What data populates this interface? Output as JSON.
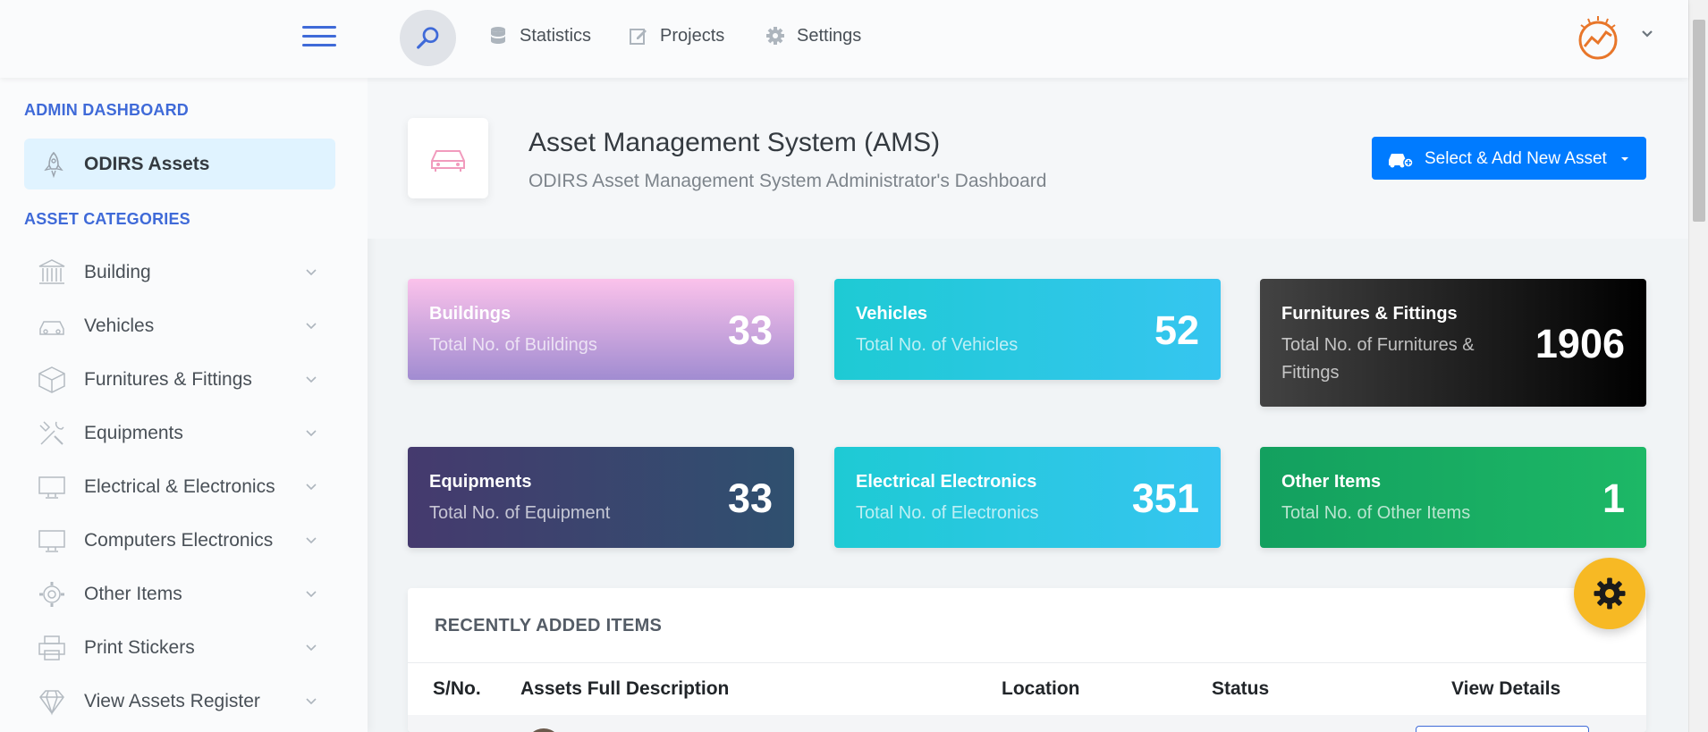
{
  "header": {
    "nav": [
      {
        "label": "Statistics",
        "icon": "database-icon"
      },
      {
        "label": "Projects",
        "icon": "edit-icon"
      },
      {
        "label": "Settings",
        "icon": "gear-icon"
      }
    ]
  },
  "sidebar": {
    "admin_heading": "ADMIN DASHBOARD",
    "active_item": {
      "label": "ODIRS Assets",
      "icon": "rocket-icon"
    },
    "categories_heading": "ASSET CATEGORIES",
    "items": [
      {
        "label": "Building",
        "icon": "bank-icon"
      },
      {
        "label": "Vehicles",
        "icon": "car-icon"
      },
      {
        "label": "Furnitures & Fittings",
        "icon": "box-icon"
      },
      {
        "label": "Equipments",
        "icon": "tools-icon"
      },
      {
        "label": "Electrical & Electronics",
        "icon": "monitor-icon"
      },
      {
        "label": "Computers Electronics",
        "icon": "monitor-icon"
      },
      {
        "label": "Other Items",
        "icon": "gear-icon"
      },
      {
        "label": "Print Stickers",
        "icon": "printer-icon"
      },
      {
        "label": "View Assets Register",
        "icon": "diamond-icon"
      }
    ]
  },
  "page": {
    "title": "Asset Management System (AMS)",
    "subtitle": "ODIRS Asset Management System Administrator's Dashboard",
    "add_button": "Select & Add New Asset"
  },
  "cards": [
    {
      "title": "Buildings",
      "subtitle": "Total No. of Buildings",
      "value": "33"
    },
    {
      "title": "Vehicles",
      "subtitle": "Total No. of Vehicles",
      "value": "52"
    },
    {
      "title": "Furnitures & Fittings",
      "subtitle": "Total No. of Furnitures & Fittings",
      "value": "1906"
    },
    {
      "title": "Equipments",
      "subtitle": "Total No. of Equipment",
      "value": "33"
    },
    {
      "title": "Electrical Electronics",
      "subtitle": "Total No. of Electronics",
      "value": "351"
    },
    {
      "title": "Other Items",
      "subtitle": "Total No. of Other Items",
      "value": "1"
    }
  ],
  "recent": {
    "title": "RECENTLY ADDED ITEMS",
    "columns": [
      "S/No.",
      "Assets Full Description",
      "Location",
      "Status",
      "View Details"
    ]
  },
  "colors": {
    "accent": "#3f6ad8",
    "primary_button": "#007bff",
    "fab": "#f7b924"
  }
}
